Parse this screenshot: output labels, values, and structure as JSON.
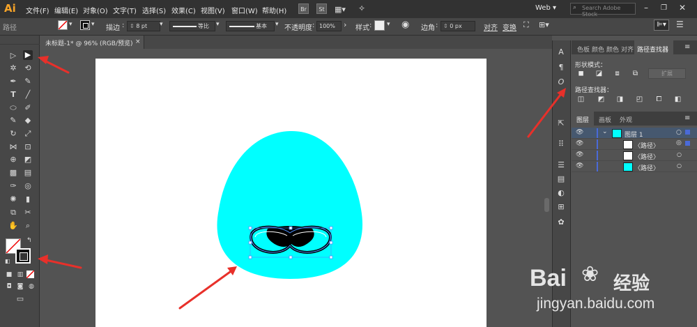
{
  "app": {
    "logo": "Ai",
    "workspace": "Web",
    "search_placeholder": "Search Adobe Stock"
  },
  "menus": [
    "文件(F)",
    "编辑(E)",
    "对象(O)",
    "文字(T)",
    "选择(S)",
    "效果(C)",
    "视图(V)",
    "窗口(W)",
    "帮助(H)"
  ],
  "app_icons": [
    "Br",
    "St"
  ],
  "control_bar": {
    "selection_type": "路径",
    "stroke_label": "描边",
    "stroke_weight": "8 pt",
    "profile_uniform": "等比",
    "brush_basic": "基本",
    "opacity_label": "不透明度",
    "opacity_value": "100%",
    "style_label": "样式",
    "corner_label": "边角",
    "corner_value": "0 px",
    "align": "对齐",
    "transform": "变换"
  },
  "document_tab": {
    "title": "未标题-1* @ 96% (RGB/预览)",
    "close": "×"
  },
  "colors": {
    "cyan_fill": "#00ffff",
    "ui_dark": "#323232",
    "ui_mid": "#474747",
    "red_arrow": "#e8302a"
  },
  "panels": {
    "top_tabs": [
      "色板",
      "颜色",
      "颜色",
      "对齐",
      "路径查找器"
    ],
    "shape_modes_label": "形状模式：",
    "expand": "扩展",
    "pathfinder_label": "路径查找器：",
    "layer_tabs": [
      "图层",
      "画板",
      "外观"
    ],
    "layer_name": "图层 1",
    "sublayers": [
      "〈路径〉",
      "〈路径〉",
      "〈路径〉"
    ]
  },
  "watermark": {
    "brand": "Bai",
    "brand2": "经验",
    "url": "jingyan.baidu.com"
  }
}
